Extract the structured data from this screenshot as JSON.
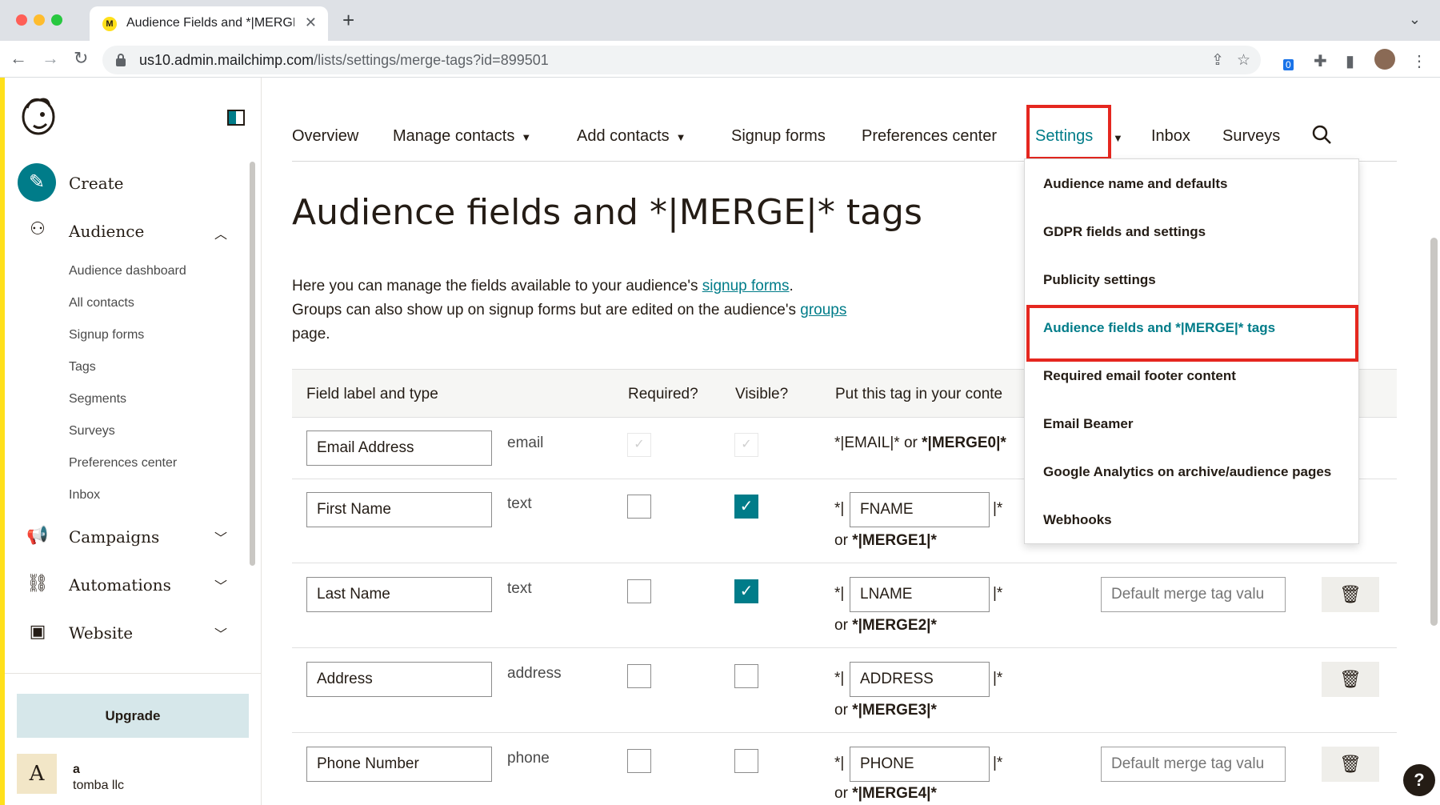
{
  "browser": {
    "tab_title": "Audience Fields and *|MERGE|*",
    "url_host": "us10.admin.mailchimp.com",
    "url_path": "/lists/settings/merge-tags?id=899501",
    "extension_badge": "0"
  },
  "sidebar": {
    "create": "Create",
    "audience": "Audience",
    "audience_items": [
      "Audience dashboard",
      "All contacts",
      "Signup forms",
      "Tags",
      "Segments",
      "Surveys",
      "Preferences center",
      "Inbox"
    ],
    "campaigns": "Campaigns",
    "automations": "Automations",
    "website": "Website",
    "upgrade": "Upgrade",
    "account_avatar": "A",
    "account_name": "a",
    "account_org": "tomba llc"
  },
  "topnav": {
    "overview": "Overview",
    "manage_contacts": "Manage contacts",
    "add_contacts": "Add contacts",
    "signup_forms": "Signup forms",
    "preferences_center": "Preferences center",
    "settings": "Settings",
    "inbox": "Inbox",
    "surveys": "Surveys"
  },
  "page": {
    "title": "Audience fields and *|MERGE|* tags",
    "intro_1": "Here you can manage the fields available to your audience's ",
    "intro_link_1": "signup forms",
    "intro_2": ".",
    "intro_3": "Groups can also show up on signup forms but are edited on the audience's ",
    "intro_link_2": "groups",
    "intro_4": "page."
  },
  "table": {
    "headers": {
      "field": "Field label and type",
      "required": "Required?",
      "visible": "Visible?",
      "tag": "Put this tag in your conte"
    },
    "email_row": {
      "label": "Email Address",
      "type": "email",
      "tag_plain": "*|EMAIL|* or ",
      "tag_bold": "*|MERGE0|*"
    },
    "rows": [
      {
        "label": "First Name",
        "type": "text",
        "tag": "FNAME",
        "merge": "*|MERGE1|*",
        "default_placeholder": "",
        "required": false,
        "visible": true
      },
      {
        "label": "Last Name",
        "type": "text",
        "tag": "LNAME",
        "merge": "*|MERGE2|*",
        "default_placeholder": "Default merge tag valu",
        "required": false,
        "visible": true
      },
      {
        "label": "Address",
        "type": "address",
        "tag": "ADDRESS",
        "merge": "*|MERGE3|*",
        "default_placeholder": "",
        "required": false,
        "visible": false
      },
      {
        "label": "Phone Number",
        "type": "phone",
        "tag": "PHONE",
        "merge": "*|MERGE4|*",
        "default_placeholder": "Default merge tag valu",
        "required": false,
        "visible": false
      }
    ],
    "pipe_open": "*|",
    "pipe_close": "|*",
    "or_label": "or "
  },
  "settings_menu": {
    "items": [
      "Audience name and defaults",
      "GDPR fields and settings",
      "Publicity settings",
      "Audience fields and *|MERGE|* tags",
      "Required email footer content",
      "Email Beamer",
      "Google Analytics on archive/audience pages",
      "Webhooks"
    ],
    "active_index": 3
  },
  "help": "?",
  "colors": {
    "brand_teal": "#007c89",
    "brand_yellow": "#ffe01b",
    "highlight_red": "#e5271f"
  },
  "icons": {
    "create": "pencil-icon",
    "audience": "people-icon",
    "campaigns": "megaphone-icon",
    "automations": "workflow-icon",
    "website": "website-icon",
    "delete": "trash-icon"
  }
}
